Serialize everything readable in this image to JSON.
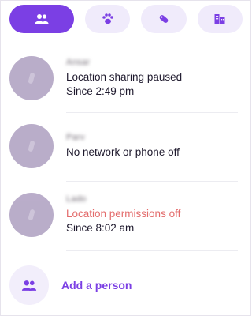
{
  "tabs": [
    {
      "icon": "people-icon",
      "active": true
    },
    {
      "icon": "paw-icon",
      "active": false
    },
    {
      "icon": "tag-icon",
      "active": false
    },
    {
      "icon": "building-icon",
      "active": false
    }
  ],
  "people": [
    {
      "name": "Ansar",
      "line1": "Location sharing paused",
      "line2": "Since 2:49 pm",
      "line1_warn": false
    },
    {
      "name": "Parv",
      "line1": "No network or phone off",
      "line2": "",
      "line1_warn": false
    },
    {
      "name": "Lado",
      "line1": "Location permissions off",
      "line2": "Since 8:02 am",
      "line1_warn": true
    }
  ],
  "add_person": {
    "label": "Add a person",
    "icon": "people-icon"
  },
  "colors": {
    "accent": "#7b3fe4",
    "warn": "#e36b6b",
    "avatar": "#b6a9c7",
    "tab_bg": "#f0ebfb"
  }
}
